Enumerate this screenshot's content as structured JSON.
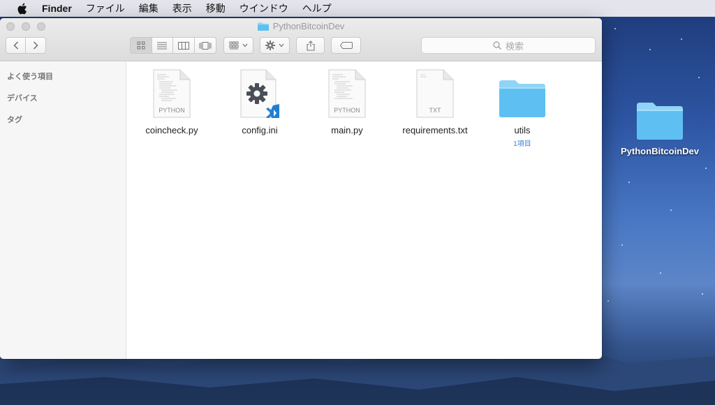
{
  "menubar": {
    "app_name": "Finder",
    "items": [
      "ファイル",
      "編集",
      "表示",
      "移動",
      "ウインドウ",
      "ヘルプ"
    ]
  },
  "window": {
    "title": "PythonBitcoinDev",
    "search_placeholder": "検索"
  },
  "sidebar": {
    "sections": [
      "よく使う項目",
      "デバイス",
      "タグ"
    ]
  },
  "files": [
    {
      "name": "coincheck.py",
      "type": "PYTHON",
      "kind": "doc"
    },
    {
      "name": "config.ini",
      "type": "",
      "kind": "config"
    },
    {
      "name": "main.py",
      "type": "PYTHON",
      "kind": "doc"
    },
    {
      "name": "requirements.txt",
      "type": "TXT",
      "kind": "doc"
    },
    {
      "name": "utils",
      "sub": "1項目",
      "kind": "folder"
    }
  ],
  "desktop": {
    "folder_name": "PythonBitcoinDev"
  },
  "colors": {
    "folder": "#5ec0f2",
    "folder_tab": "#8fd4f7",
    "vscode_blue": "#1f7fd1"
  }
}
